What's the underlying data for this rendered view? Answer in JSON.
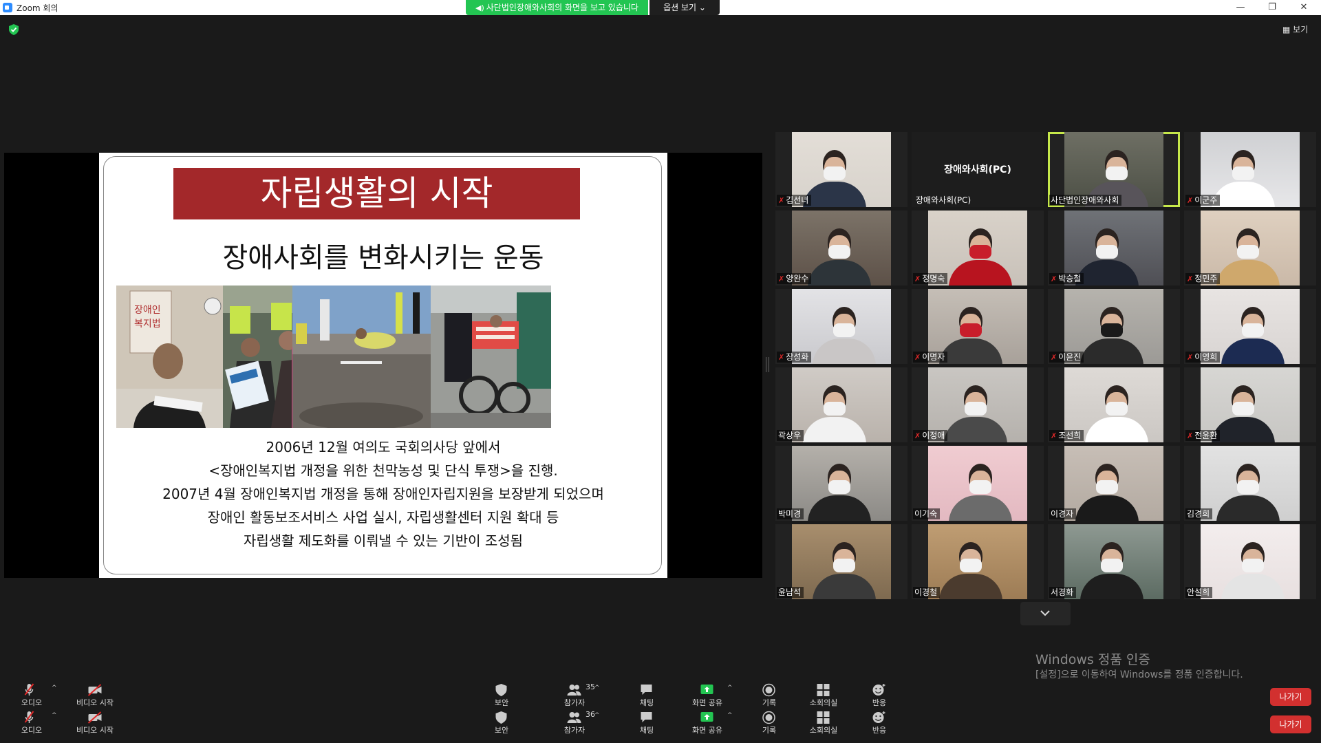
{
  "window": {
    "title": "Zoom 회의"
  },
  "share_banner": {
    "text": "사단법인장애와사회의 화면을 보고 있습니다",
    "options_label": "옵션 보기"
  },
  "view_label": "보기",
  "slide": {
    "title": "자립생활의 시작",
    "subtitle": "장애사회를 변화시키는 운동",
    "photo_sign_text": "장애인 복지법",
    "lines": [
      "2006년 12월 여의도 국회의사당 앞에서",
      "<장애인복지법 개정을 위한 천막농성 및 단식 투쟁>을 진행.",
      "2007년 4월 장애인복지법 개정을 통해 장애인자립지원을 보장받게 되었으며",
      "장애인 활동보조서비스 사업 실시, 자립생활센터 지원 확대 등",
      "자립생활 제도화를 이뤄낼 수 있는 기반이 조성됨"
    ]
  },
  "participants": [
    {
      "name": "김선녀",
      "muted": true
    },
    {
      "name": "장애와사회(PC)",
      "muted": false,
      "video_off": true,
      "center_label": "장애와사회(PC)"
    },
    {
      "name": "사단법인장애와사회",
      "muted": false,
      "active_speaker": true
    },
    {
      "name": "이군주",
      "muted": true
    },
    {
      "name": "양완수",
      "muted": true
    },
    {
      "name": "정명숙",
      "muted": true
    },
    {
      "name": "박승철",
      "muted": true
    },
    {
      "name": "정민주",
      "muted": true
    },
    {
      "name": "장성화",
      "muted": true
    },
    {
      "name": "이명자",
      "muted": true
    },
    {
      "name": "이윤진",
      "muted": true
    },
    {
      "name": "이영희",
      "muted": true
    },
    {
      "name": "곽상우",
      "muted": false
    },
    {
      "name": "이정애",
      "muted": true
    },
    {
      "name": "조선희",
      "muted": true
    },
    {
      "name": "전윤환",
      "muted": true
    },
    {
      "name": "박미경",
      "muted": false
    },
    {
      "name": "이기숙",
      "muted": false
    },
    {
      "name": "이경자",
      "muted": false
    },
    {
      "name": "김경희",
      "muted": false
    },
    {
      "name": "윤남석",
      "muted": false
    },
    {
      "name": "이경철",
      "muted": false
    },
    {
      "name": "서경화",
      "muted": false
    },
    {
      "name": "안설희",
      "muted": false
    }
  ],
  "toolbar_rows": [
    {
      "participants_count": "35"
    },
    {
      "participants_count": "36"
    }
  ],
  "toolbar": {
    "audio": "오디오",
    "video": "비디오 시작",
    "security": "보안",
    "participants": "참가자",
    "chat": "채팅",
    "share": "화면 공유",
    "record": "기록",
    "breakout": "소회의실",
    "reactions": "반응",
    "leave": "나가기"
  },
  "watermark": {
    "title": "Windows 정품 인증",
    "text": "[설정]으로 이동하여 Windows를 정품 인증합니다."
  },
  "colors": {
    "title_red": "#a3282a",
    "banner_green": "#23c552",
    "leave_red": "#d2302f",
    "active_outline": "#c6e84a"
  }
}
